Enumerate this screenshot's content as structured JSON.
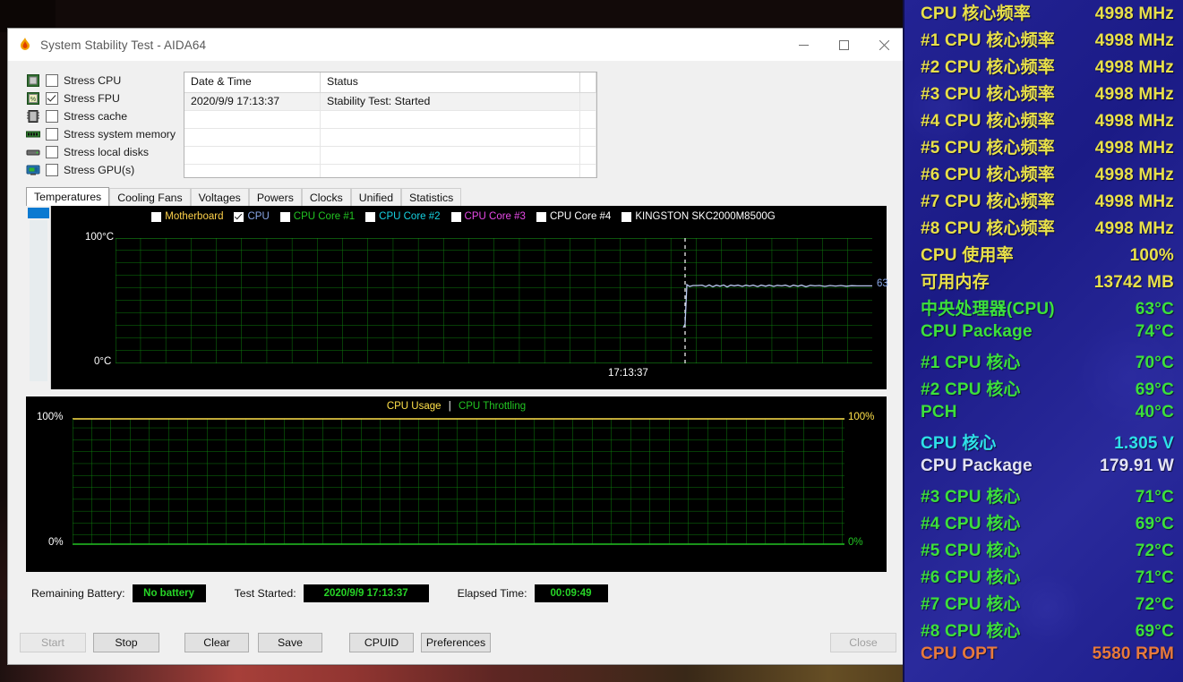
{
  "window": {
    "title": "System Stability Test - AIDA64",
    "icon": "flame-icon",
    "controls": {
      "minimize": "minimize-icon",
      "maximize": "maximize-icon",
      "close": "close-icon"
    }
  },
  "stress_options": [
    {
      "label": "Stress CPU",
      "checked": false,
      "icon": "cpu-chip-icon"
    },
    {
      "label": "Stress FPU",
      "checked": true,
      "icon": "fpu-icon"
    },
    {
      "label": "Stress cache",
      "checked": false,
      "icon": "cache-icon"
    },
    {
      "label": "Stress system memory",
      "checked": false,
      "icon": "memory-module-icon"
    },
    {
      "label": "Stress local disks",
      "checked": false,
      "icon": "hard-disk-icon"
    },
    {
      "label": "Stress GPU(s)",
      "checked": false,
      "icon": "gpu-monitor-icon"
    }
  ],
  "status_table": {
    "columns": [
      "Date & Time",
      "Status",
      ""
    ],
    "rows": [
      [
        "2020/9/9 17:13:37",
        "Stability Test: Started",
        ""
      ],
      [
        "",
        "",
        ""
      ],
      [
        "",
        "",
        ""
      ],
      [
        "",
        "",
        ""
      ],
      [
        "",
        "",
        ""
      ]
    ]
  },
  "tabs": [
    {
      "label": "Temperatures",
      "active": true
    },
    {
      "label": "Cooling Fans",
      "active": false
    },
    {
      "label": "Voltages",
      "active": false
    },
    {
      "label": "Powers",
      "active": false
    },
    {
      "label": "Clocks",
      "active": false
    },
    {
      "label": "Unified",
      "active": false
    },
    {
      "label": "Statistics",
      "active": false
    }
  ],
  "chart_data": [
    {
      "type": "line",
      "name": "temperature-chart",
      "title": "",
      "ylabel": "",
      "ytick_top": "100°C",
      "ytick_bottom": "0°C",
      "ylim": [
        0,
        100
      ],
      "grid": true,
      "grid_color": "#0d7a0d",
      "background": "#000000",
      "xlabel": "",
      "x_tick_label": "17:13:37",
      "legend_position": "top",
      "legend": [
        {
          "label": "Motherboard",
          "color": "#ffd24a",
          "checked": false
        },
        {
          "label": "CPU",
          "color": "#8aa8e8",
          "checked": true
        },
        {
          "label": "CPU Core #1",
          "color": "#22c422",
          "checked": false
        },
        {
          "label": "CPU Core #2",
          "color": "#16d2e2",
          "checked": false
        },
        {
          "label": "CPU Core #3",
          "color": "#e84ae8",
          "checked": false
        },
        {
          "label": "CPU Core #4",
          "color": "#ffffff",
          "checked": false
        },
        {
          "label": "KINGSTON SKC2000M8500G",
          "color": "#ffffff",
          "checked": false
        }
      ],
      "series": [
        {
          "name": "CPU",
          "color": "#b9c9f0",
          "current_value_label": "63",
          "unit": "°C",
          "values": [
            35,
            63,
            63,
            64,
            63,
            63,
            64,
            63,
            63,
            64,
            63,
            64,
            63,
            63,
            64,
            63,
            63,
            64,
            63,
            63,
            64,
            63,
            64,
            63,
            63,
            64,
            63,
            63,
            64,
            63,
            63,
            64,
            63,
            63,
            63,
            64,
            63,
            63,
            63,
            63
          ]
        }
      ]
    },
    {
      "type": "line",
      "name": "cpu-usage-chart",
      "ylim": [
        0,
        100
      ],
      "grid": true,
      "grid_color": "#0d7a0d",
      "background": "#000000",
      "left_tick_top": "100%",
      "left_tick_bottom": "0%",
      "right_tick_top": "100%",
      "right_tick_bottom": "0%",
      "right_tick_top_color": "#ffe14a",
      "right_tick_bottom_color": "#22c422",
      "legend_position": "top-center",
      "legend": [
        {
          "label": "CPU Usage",
          "color": "#ffe14a"
        },
        {
          "label": "|",
          "color": "#ffffff"
        },
        {
          "label": "CPU Throttling",
          "color": "#22c422"
        }
      ],
      "series": [
        {
          "name": "CPU Usage",
          "color": "#ffe14a",
          "values": [
            100,
            100,
            100,
            100,
            100,
            100,
            100,
            100,
            100,
            100
          ]
        },
        {
          "name": "CPU Throttling",
          "color": "#22c422",
          "values": [
            0,
            0,
            0,
            0,
            0,
            0,
            0,
            0,
            0,
            0
          ]
        }
      ]
    }
  ],
  "footer": {
    "battery_label": "Remaining Battery:",
    "battery_value": "No battery",
    "started_label": "Test Started:",
    "started_value": "2020/9/9 17:13:37",
    "elapsed_label": "Elapsed Time:",
    "elapsed_value": "00:09:49"
  },
  "buttons": [
    {
      "label": "Start",
      "disabled": true
    },
    {
      "label": "Stop",
      "disabled": false
    },
    {
      "label": "Clear",
      "disabled": false
    },
    {
      "label": "Save",
      "disabled": false
    },
    {
      "label": "CPUID",
      "disabled": false
    },
    {
      "label": "Preferences",
      "disabled": false
    },
    {
      "label": "Close",
      "disabled": true
    }
  ],
  "osd": {
    "background": "#232394",
    "rows": [
      {
        "key": "CPU 核心频率",
        "value": "4998 MHz",
        "color": "#e8e04a"
      },
      {
        "key": "#1 CPU 核心频率",
        "value": "4998 MHz",
        "color": "#e8e04a"
      },
      {
        "key": "#2 CPU 核心频率",
        "value": "4998 MHz",
        "color": "#e8e04a"
      },
      {
        "key": "#3 CPU 核心频率",
        "value": "4998 MHz",
        "color": "#e8e04a"
      },
      {
        "key": "#4 CPU 核心频率",
        "value": "4998 MHz",
        "color": "#e8e04a"
      },
      {
        "key": "#5 CPU 核心频率",
        "value": "4998 MHz",
        "color": "#e8e04a"
      },
      {
        "key": "#6 CPU 核心频率",
        "value": "4998 MHz",
        "color": "#e8e04a"
      },
      {
        "key": "#7 CPU 核心频率",
        "value": "4998 MHz",
        "color": "#e8e04a"
      },
      {
        "key": "#8 CPU 核心频率",
        "value": "4998 MHz",
        "color": "#e8e04a"
      },
      {
        "key": "CPU 使用率",
        "value": "100%",
        "color": "#e8e04a"
      },
      {
        "key": "可用内存",
        "value": "13742 MB",
        "color": "#e8e04a"
      },
      {
        "key": "中央处理器(CPU)",
        "value": "63°C",
        "color": "#3ce03c"
      },
      {
        "key": "CPU Package",
        "value": "74°C",
        "color": "#3ce03c"
      },
      {
        "key": " #1 CPU 核心",
        "value": "70°C",
        "color": "#3ce03c"
      },
      {
        "key": " #2 CPU 核心",
        "value": "69°C",
        "color": "#3ce03c"
      },
      {
        "key": "PCH",
        "value": "40°C",
        "color": "#3ce03c"
      },
      {
        "key": "CPU 核心",
        "value": "1.305 V",
        "color": "#2ee0e8"
      },
      {
        "key": "CPU Package",
        "value": "179.91 W",
        "color": "#e4e4f4"
      },
      {
        "key": " #3 CPU 核心",
        "value": "71°C",
        "color": "#3ce03c"
      },
      {
        "key": " #4 CPU 核心",
        "value": "69°C",
        "color": "#3ce03c"
      },
      {
        "key": " #5 CPU 核心",
        "value": "72°C",
        "color": "#3ce03c"
      },
      {
        "key": " #6 CPU 核心",
        "value": "71°C",
        "color": "#3ce03c"
      },
      {
        "key": " #7 CPU 核心",
        "value": "72°C",
        "color": "#3ce03c"
      },
      {
        "key": " #8 CPU 核心",
        "value": "69°C",
        "color": "#3ce03c"
      },
      {
        "key": "CPU OPT",
        "value": "5580 RPM",
        "color": "#e87a3c"
      }
    ]
  }
}
